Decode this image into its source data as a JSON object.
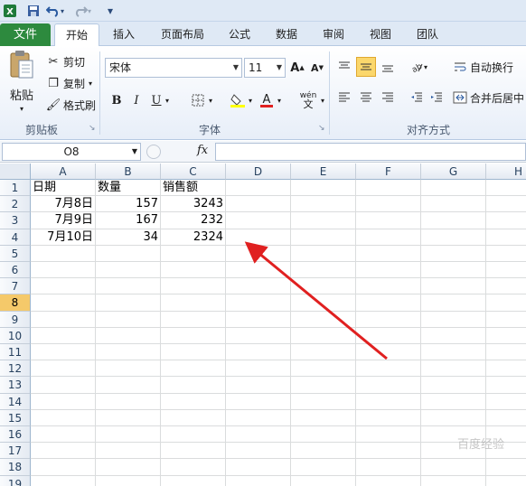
{
  "qat": {
    "app_icon": "excel-icon",
    "save_icon": "save-icon",
    "undo_icon": "undo-icon",
    "redo_icon": "redo-icon",
    "customize_glyph": "▾"
  },
  "tabs": [
    {
      "label": "文件"
    },
    {
      "label": "开始"
    },
    {
      "label": "插入"
    },
    {
      "label": "页面布局"
    },
    {
      "label": "公式"
    },
    {
      "label": "数据"
    },
    {
      "label": "审阅"
    },
    {
      "label": "视图"
    },
    {
      "label": "团队"
    }
  ],
  "ribbon": {
    "clipboard": {
      "paste": "粘贴",
      "cut": "剪切",
      "copy": "复制",
      "format_painter": "格式刷",
      "group_label": "剪贴板"
    },
    "font": {
      "font_name": "宋体",
      "font_size": "11",
      "bold": "B",
      "italic": "I",
      "underline": "U",
      "phonetic": "wén",
      "group_label": "字体"
    },
    "alignment": {
      "wrap_text": "自动换行",
      "merge_center": "合并后居中",
      "group_label": "对齐方式"
    }
  },
  "formula_bar": {
    "name_box": "O8",
    "fx": "fx",
    "formula": ""
  },
  "sheet": {
    "columns": [
      "A",
      "B",
      "C",
      "D",
      "E",
      "F",
      "G",
      "H"
    ],
    "rows": [
      "1",
      "2",
      "3",
      "4",
      "5",
      "6",
      "7",
      "8",
      "9",
      "10",
      "11",
      "12",
      "13",
      "14",
      "15",
      "16",
      "17",
      "18",
      "19"
    ],
    "selected_row": "8",
    "cells": {
      "A1": "日期",
      "B1": "数量",
      "C1": "销售额",
      "A2": "7月8日",
      "B2": "157",
      "C2": "3243",
      "A3": "7月9日",
      "B3": "167",
      "C3": "232",
      "A4": "7月10日",
      "B4": "34",
      "C4": "2324"
    }
  },
  "annotation": {
    "arrow_color": "#e02020"
  },
  "watermark": "百度经验"
}
